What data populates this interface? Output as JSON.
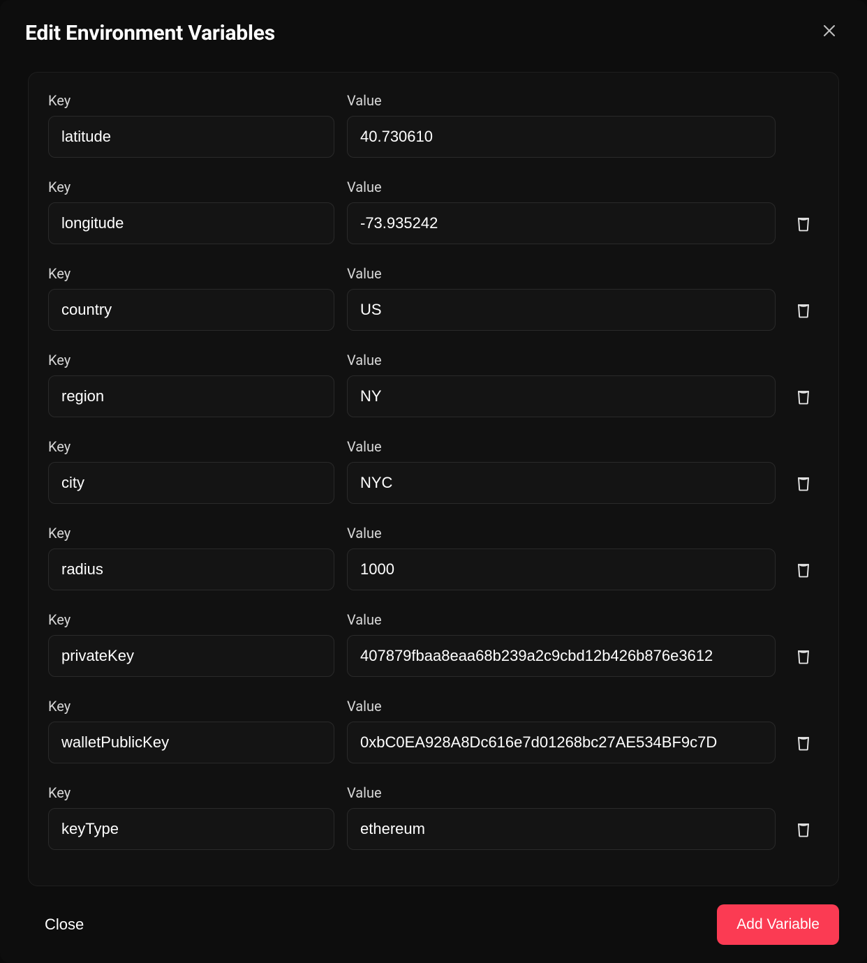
{
  "modal": {
    "title": "Edit Environment Variables",
    "close_button_label": "Close",
    "add_button_label": "Add Variable",
    "labels": {
      "key": "Key",
      "value": "Value"
    },
    "rows": [
      {
        "key": "latitude",
        "value": "40.730610",
        "deletable": false
      },
      {
        "key": "longitude",
        "value": "-73.935242",
        "deletable": true
      },
      {
        "key": "country",
        "value": "US",
        "deletable": true
      },
      {
        "key": "region",
        "value": "NY",
        "deletable": true
      },
      {
        "key": "city",
        "value": "NYC",
        "deletable": true
      },
      {
        "key": "radius",
        "value": "1000",
        "deletable": true
      },
      {
        "key": "privateKey",
        "value": "407879fbaa8eaa68b239a2c9cbd12b426b876e3612",
        "deletable": true
      },
      {
        "key": "walletPublicKey",
        "value": "0xbC0EA928A8Dc616e7d01268bc27AE534BF9c7D",
        "deletable": true
      },
      {
        "key": "keyType",
        "value": "ethereum",
        "deletable": true
      }
    ]
  }
}
